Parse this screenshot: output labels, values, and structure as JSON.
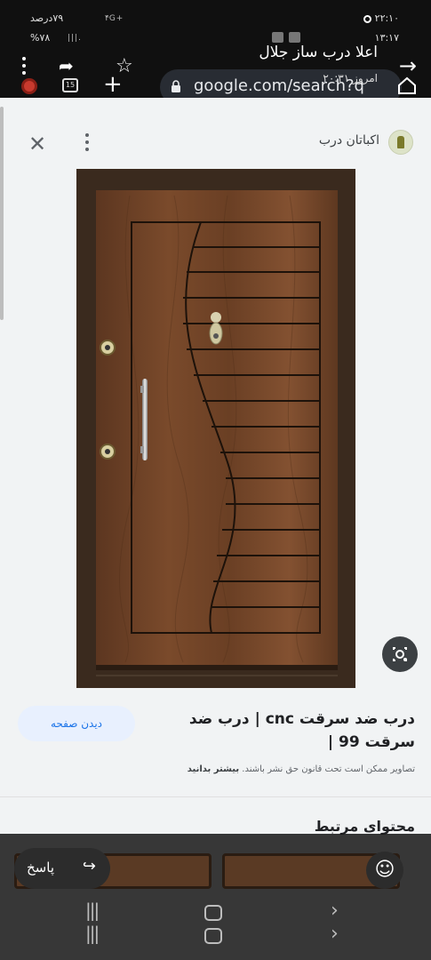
{
  "status_bar": {
    "time_top": "۲۲:۱۰",
    "battery_top": "۷۹درصد",
    "signal_top": "۴G+",
    "time_bottom": "۱۳:۱۷",
    "battery_bottom": "%۷۸",
    "network_bottom": "|||.",
    "icons_bottom": "⚙ ▥ ▤"
  },
  "chat": {
    "title": "اعلا درب ساز جلال",
    "subtitle": "امروز ۲۰:۳۱"
  },
  "browser": {
    "url": "google.com/search?q",
    "tab_count": "15",
    "star_icon": "☆",
    "forward_icon": "➦",
    "plus_icon": "+"
  },
  "viewer": {
    "close_icon": "✕",
    "source_name": "اکباتان درب",
    "source_logo_color": "#dde3c8"
  },
  "result": {
    "title": "درب ضد سرقت cnc | درب ضد سرقت 99 |",
    "visit_label": "دیدن صفحه",
    "copyright_text": "تصاویر ممکن است تحت قانون حق نشر باشند.",
    "learn_more": "بیشتر بدانید",
    "related_title": "محتوای مرتبط"
  },
  "overlay": {
    "reply_label": "پاسخ",
    "reply_icon": "↪",
    "emoji_icon": "☺"
  },
  "nav": {
    "recents": "|||",
    "back": "›"
  },
  "colors": {
    "accent": "#1a73e8",
    "door_wood": "#6b4227",
    "door_frame": "#3a2a1e"
  }
}
